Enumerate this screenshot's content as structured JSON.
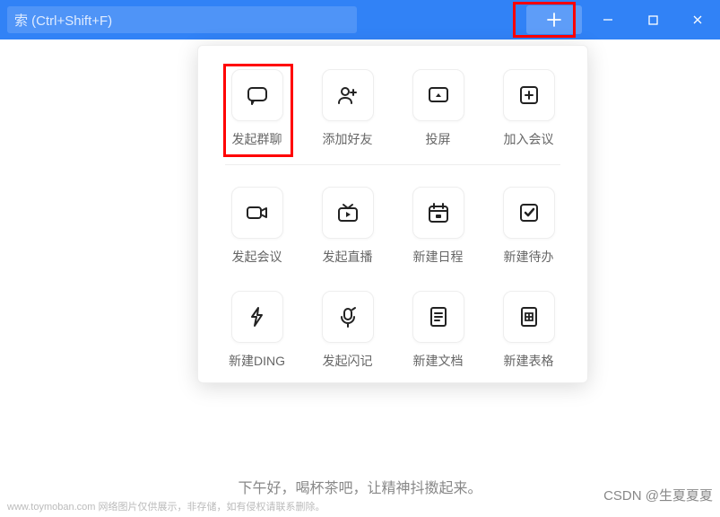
{
  "titlebar": {
    "search_hint": "索 (Ctrl+Shift+F)"
  },
  "dropdown": {
    "row1": [
      {
        "label": "发起群聊",
        "icon": "chat-icon",
        "highlighted": true
      },
      {
        "label": "添加好友",
        "icon": "add-friend-icon"
      },
      {
        "label": "投屏",
        "icon": "cast-icon"
      },
      {
        "label": "加入会议",
        "icon": "join-meeting-icon"
      }
    ],
    "row2": [
      {
        "label": "发起会议",
        "icon": "video-icon"
      },
      {
        "label": "发起直播",
        "icon": "live-icon"
      },
      {
        "label": "新建日程",
        "icon": "calendar-icon"
      },
      {
        "label": "新建待办",
        "icon": "todo-icon"
      }
    ],
    "row3": [
      {
        "label": "新建DING",
        "icon": "ding-icon"
      },
      {
        "label": "发起闪记",
        "icon": "flash-note-icon"
      },
      {
        "label": "新建文档",
        "icon": "doc-icon"
      },
      {
        "label": "新建表格",
        "icon": "sheet-icon"
      }
    ]
  },
  "greeting": "下午好，喝杯茶吧，让精神抖擞起来。",
  "watermark_left": "www.toymoban.com  网络图片仅供展示，非存储，如有侵权请联系删除。",
  "watermark_right": "CSDN @生夏夏夏"
}
